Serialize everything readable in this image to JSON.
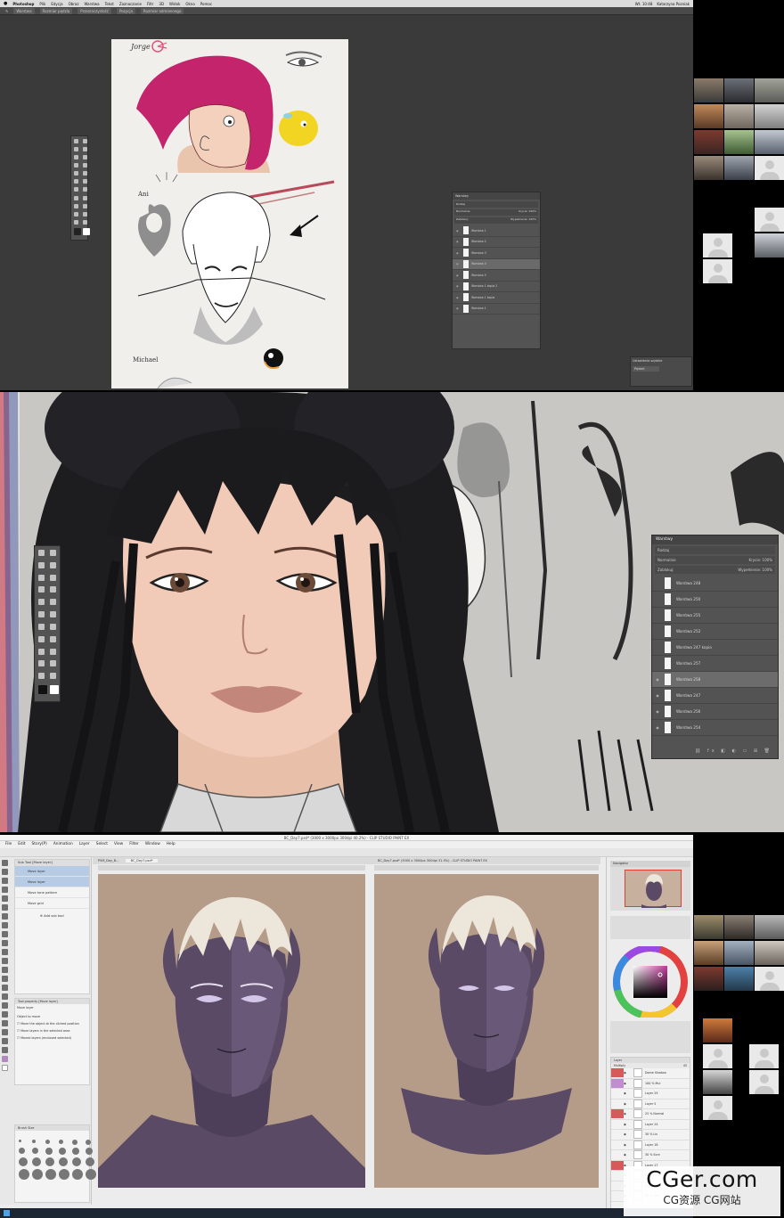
{
  "photoshop": {
    "menubar": {
      "apple": "",
      "items": [
        "Photoshop",
        "Plik",
        "Edycja",
        "Obraz",
        "Warstwa",
        "Tekst",
        "Zaznaczanie",
        "Filtr",
        "3D",
        "Widok",
        "Okno",
        "Pomoc"
      ],
      "clock": "Wt. 10:48",
      "user": "Katarzyna Pozniak"
    },
    "options_bar": [
      "Warstwa",
      "Rozmiar pędzla",
      "Przezroczystość",
      "Pozycja",
      "Rozmiar odmiennego"
    ],
    "canvas_labels": {
      "jorge": "Jorge",
      "ani": "Ani",
      "michael": "Michael"
    },
    "layers_panel": {
      "title": "Warstwy",
      "search": "Rodzaj",
      "blend": "Normalnie",
      "opacity": "Krycie: 100%",
      "lock": "Zablokuj:",
      "fill": "Wypełnienie: 100%",
      "layers": [
        {
          "name": "Warstwa 1",
          "selected": false
        },
        {
          "name": "Warstwa 2",
          "selected": false
        },
        {
          "name": "Warstwa 3",
          "selected": false
        },
        {
          "name": "Warstwa 4",
          "selected": true
        },
        {
          "name": "Warstwa 5",
          "selected": false
        },
        {
          "name": "Warstwa 1 kopia 2",
          "selected": false
        },
        {
          "name": "Warstwa 1 kopia",
          "selected": false
        },
        {
          "name": "Warstwa 1",
          "selected": false
        }
      ]
    },
    "mini_panel": {
      "title": "Ustawienia szybkie",
      "item": "Pędzel"
    }
  },
  "session2": {
    "layers_panel": {
      "title": "Warstwy",
      "search": "Rodzaj",
      "blend": "Normalnie",
      "opacity": "Krycie: 100%",
      "lock": "Zablokuj:",
      "fill": "Wypełnienie: 100%",
      "layers": [
        {
          "name": "Warstwa 248",
          "selected": false,
          "eye": false
        },
        {
          "name": "Warstwa 250",
          "selected": false,
          "eye": false
        },
        {
          "name": "Warstwa 255",
          "selected": false,
          "eye": false
        },
        {
          "name": "Warstwa 252",
          "selected": false,
          "eye": false
        },
        {
          "name": "Warstwa 247 kopia",
          "selected": false,
          "eye": false
        },
        {
          "name": "Warstwa 257",
          "selected": false,
          "eye": false
        },
        {
          "name": "Warstwa 258",
          "selected": true,
          "eye": true
        },
        {
          "name": "Warstwa 247",
          "selected": false,
          "eye": true
        },
        {
          "name": "Warstwa 256",
          "selected": false,
          "eye": true
        },
        {
          "name": "Warstwa 254",
          "selected": false,
          "eye": true
        }
      ]
    }
  },
  "clipstudio": {
    "title": "BC_Day7.psd* (3000 x 3000px 300dpi 40.2%) - CLIP STUDIO PAINT EX",
    "menu": [
      "File",
      "Edit",
      "Story(P)",
      "Animation",
      "Layer",
      "Select",
      "View",
      "Filter",
      "Window",
      "Help"
    ],
    "doc_tabs": [
      "PSM_Day_B...",
      "BC_Day7.psd*"
    ],
    "docB_title": "BC_Day7.psd* (3000 x 3000px 300dpi 31.5%) - CLIP STUDIO PAINT EX",
    "subtool": {
      "header": "Sub Tool [Move layer]",
      "items": [
        {
          "name": "Move layer",
          "selected": true
        },
        {
          "name": "Move layer",
          "selected": true
        },
        {
          "name": "Move tone pattern",
          "selected": false
        },
        {
          "name": "Move grid",
          "selected": false
        }
      ],
      "add": "Add sub tool"
    },
    "tool_property": {
      "header": "Tool property [Move layer]",
      "title": "Move layer",
      "object": "Object to move",
      "opt1": "Move the object at the clicked position",
      "opt2": "Move layers in the selected area",
      "opt3": "Moved layers (enclosed selected)"
    },
    "brush_panel": {
      "header": "Brush Size"
    },
    "navigator": {
      "title": "Navigator"
    },
    "layer_panel": {
      "title": "Layer",
      "blend": "Multiply",
      "opacity": "45",
      "layers": [
        {
          "name": "Dome Shadow",
          "color": "#d75a5a"
        },
        {
          "name": "100 % Mul",
          "color": "#c08ed0"
        },
        {
          "name": "Layer 29",
          "color": ""
        },
        {
          "name": "Layer 5",
          "color": ""
        },
        {
          "name": "25 % Normal",
          "color": "#d75a5a"
        },
        {
          "name": "Layer 24",
          "color": ""
        },
        {
          "name": "30 % Lin",
          "color": ""
        },
        {
          "name": "Layer 18",
          "color": ""
        },
        {
          "name": "30 % Scre",
          "color": ""
        },
        {
          "name": "Layer 17",
          "color": "#d75a5a"
        },
        {
          "name": "50 % Scre",
          "color": ""
        },
        {
          "name": "Layer 14.3",
          "color": ""
        },
        {
          "name": "50 % Scre",
          "color": ""
        }
      ]
    }
  },
  "watermark": {
    "line1": "CGer.com",
    "line2": "CG资源 CG网站"
  },
  "colors": {
    "accent_red": "#d75a5a",
    "skin_purple": "#5a4a66",
    "hair_white": "#ede6da",
    "canvas_bg": "#b49c89"
  }
}
